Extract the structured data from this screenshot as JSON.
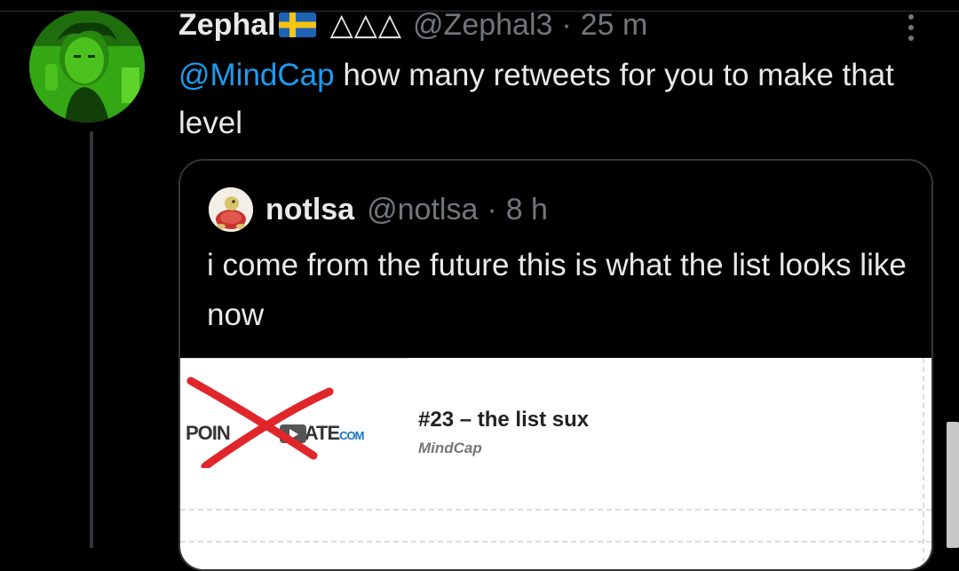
{
  "tweet": {
    "display_name": "Zephal",
    "flag_icon": "sweden-flag-icon",
    "decoration": "△△△",
    "handle": "@Zephal3",
    "separator": "·",
    "time": "25 m",
    "more_icon": "more-vertical-icon",
    "mention": "@MindCap",
    "text": " how many retweets for you to make that level"
  },
  "quote": {
    "display_name": "notlsa",
    "handle": "@notlsa",
    "separator": "·",
    "time": "8 h",
    "text": "i come from the future this is what the list looks like now",
    "embed": {
      "thumbnail_text": "POIN",
      "thumbnail_text_tail": "ATE",
      "thumbnail_com": "COM",
      "title": "#23 – the list sux",
      "author": "MindCap"
    }
  },
  "colors": {
    "background": "#000000",
    "text": "#e7e9ea",
    "secondary": "#71767b",
    "link": "#1d9bf0",
    "avatar_green": "#2e9e12",
    "strike_red": "#e0262a"
  }
}
